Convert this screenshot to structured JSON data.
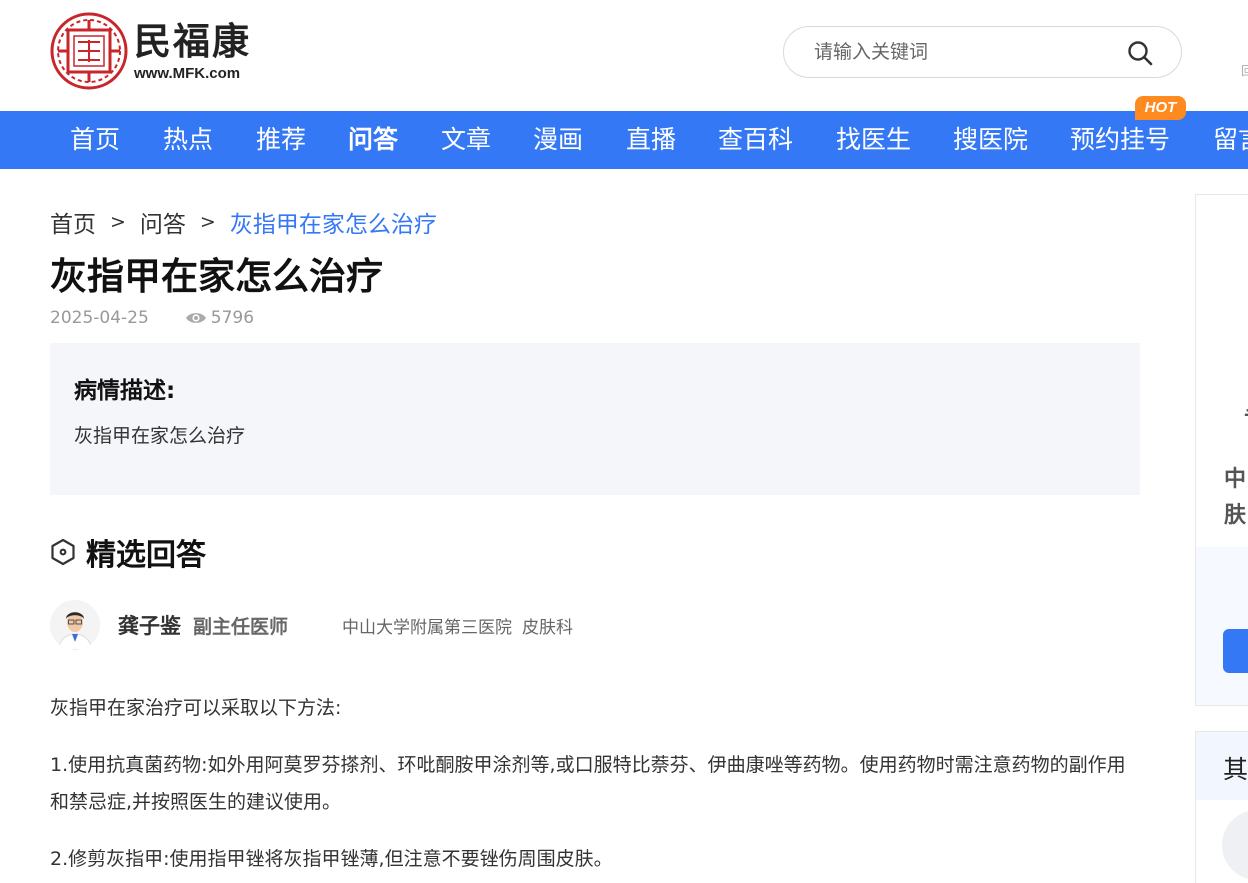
{
  "header": {
    "logo_cn": "民福康",
    "logo_seal": "民福康",
    "logo_url": "www.MFK.com",
    "search_placeholder": "请输入关键词",
    "edge_mark": "回"
  },
  "nav": {
    "items": [
      {
        "label": "首页"
      },
      {
        "label": "热点"
      },
      {
        "label": "推荐"
      },
      {
        "label": "问答",
        "active": true
      },
      {
        "label": "文章"
      },
      {
        "label": "漫画"
      },
      {
        "label": "直播"
      },
      {
        "label": "查百科"
      },
      {
        "label": "找医生"
      },
      {
        "label": "搜医院"
      },
      {
        "label": "预约挂号"
      },
      {
        "label": "留言"
      }
    ],
    "hot_badge": "HOT"
  },
  "breadcrumb": {
    "home": "首页",
    "sep": ">",
    "section": "问答",
    "current": "灰指甲在家怎么治疗"
  },
  "page": {
    "title": "灰指甲在家怎么治疗",
    "date": "2025-04-25",
    "views": "5796"
  },
  "condition": {
    "title": "病情描述:",
    "text": "灰指甲在家怎么治疗"
  },
  "answers": {
    "title": "精选回答",
    "doctor": {
      "name": "龚子鉴",
      "title": "副主任医师",
      "hospital": "中山大学附属第三医院",
      "dept": "皮肤科"
    },
    "paragraphs": [
      "灰指甲在家治疗可以采取以下方法:",
      "1.使用抗真菌药物:如外用阿莫罗芬搽剂、环吡酮胺甲涂剂等,或口服特比萘芬、伊曲康唑等药物。使用药物时需注意药物的副作用和禁忌症,并按照医生的建议使用。",
      "2.修剪灰指甲:使用指甲锉将灰指甲锉薄,但注意不要锉伤周围皮肤。"
    ]
  },
  "side": {
    "char_a": "专",
    "char_b": "中",
    "char_c": "肤",
    "panel2_title": "其"
  },
  "colors": {
    "brand_blue": "#3478f6",
    "hot_orange": "#ff8a1f",
    "box_bg": "#f5f6fa",
    "logo_red": "#c8262a"
  }
}
